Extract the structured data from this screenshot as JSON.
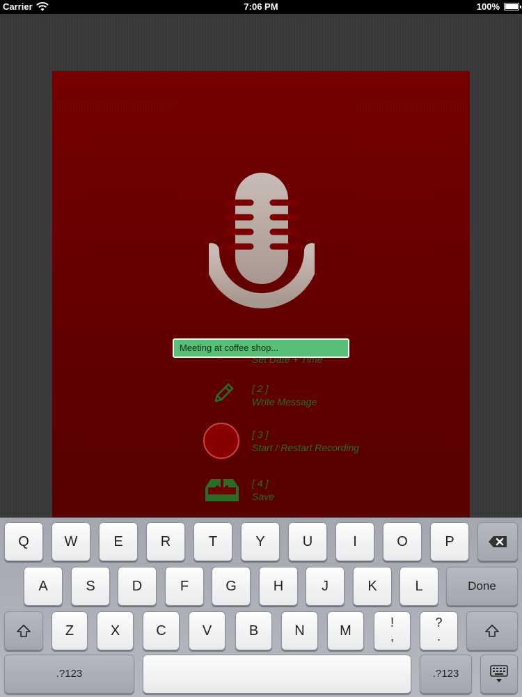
{
  "status_bar": {
    "carrier": "Carrier",
    "time": "7:06 PM",
    "battery": "100%"
  },
  "form": {
    "textbox_value": "Meeting at coffee shop...",
    "step1_label_partial": "Set Date + Time",
    "steps": [
      {
        "num": "[ 2 ]",
        "label": "Write Message",
        "icon": "pencil-icon"
      },
      {
        "num": "[ 3 ]",
        "label": "Start / Restart Recording",
        "icon": "record-button"
      },
      {
        "num": "[ 4 ]",
        "label": "Save",
        "icon": "save-tray-icon"
      }
    ]
  },
  "keyboard": {
    "row1": [
      "Q",
      "W",
      "E",
      "R",
      "T",
      "Y",
      "U",
      "I",
      "O",
      "P"
    ],
    "row2": [
      "A",
      "S",
      "D",
      "F",
      "G",
      "H",
      "J",
      "K",
      "L"
    ],
    "row3": [
      "Z",
      "X",
      "C",
      "V",
      "B",
      "N",
      "M"
    ],
    "done": "Done",
    "numbers_left": ".?123",
    "numbers_right": ".?123",
    "punct1_top": "!",
    "punct1_bottom": ",",
    "punct2_top": "?",
    "punct2_bottom": "."
  },
  "colors": {
    "panel_red": "#6e0000",
    "textbox_green": "#58bf78",
    "step_text_green": "#2b6b24"
  }
}
